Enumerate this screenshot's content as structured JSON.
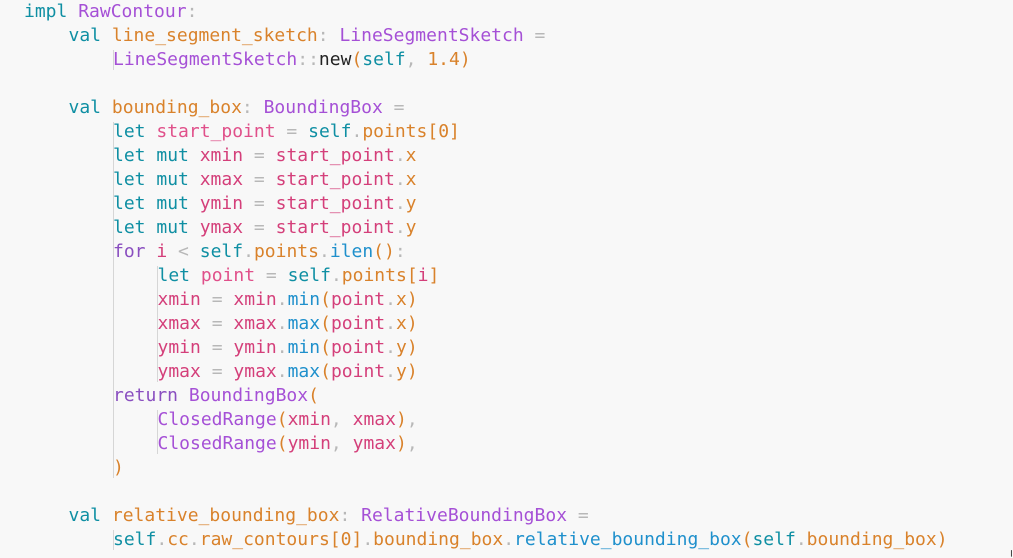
{
  "editor": {
    "language": "custom",
    "background": "#f8f8f8",
    "colors": {
      "keyword": "#0f8fa3",
      "control": "#8a4fc0",
      "type": "#a550d6",
      "property": "#d9822b",
      "binding": "#e0508a",
      "variable": "#d43f7a",
      "method": "#1f90cc",
      "number": "#d9822b",
      "punctuation": "#b8b8b8",
      "plain": "#222222"
    },
    "lines": [
      {
        "indent": 0,
        "tokens": [
          [
            "kw",
            "impl"
          ],
          [
            "plain",
            " "
          ],
          [
            "type",
            "RawContour"
          ],
          [
            "punc",
            ":"
          ]
        ]
      },
      {
        "indent": 1,
        "tokens": [
          [
            "kw",
            "val"
          ],
          [
            "plain",
            " "
          ],
          [
            "prop",
            "line_segment_sketch"
          ],
          [
            "punc",
            ":"
          ],
          [
            "plain",
            " "
          ],
          [
            "type",
            "LineSegmentSketch"
          ],
          [
            "plain",
            " "
          ],
          [
            "punc",
            "="
          ]
        ]
      },
      {
        "indent": 2,
        "tokens": [
          [
            "type",
            "LineSegmentSketch"
          ],
          [
            "punc",
            "::"
          ],
          [
            "plain",
            "new"
          ],
          [
            "brk",
            "("
          ],
          [
            "self",
            "self"
          ],
          [
            "punc",
            ","
          ],
          [
            "plain",
            " "
          ],
          [
            "num",
            "1.4"
          ],
          [
            "brk",
            ")"
          ]
        ]
      },
      {
        "indent": 0,
        "tokens": []
      },
      {
        "indent": 1,
        "tokens": [
          [
            "kw",
            "val"
          ],
          [
            "plain",
            " "
          ],
          [
            "prop",
            "bounding_box"
          ],
          [
            "punc",
            ":"
          ],
          [
            "plain",
            " "
          ],
          [
            "type",
            "BoundingBox"
          ],
          [
            "plain",
            " "
          ],
          [
            "punc",
            "="
          ]
        ]
      },
      {
        "indent": 2,
        "tokens": [
          [
            "kw",
            "let"
          ],
          [
            "plain",
            " "
          ],
          [
            "bind",
            "start_point"
          ],
          [
            "plain",
            " "
          ],
          [
            "punc",
            "="
          ],
          [
            "plain",
            " "
          ],
          [
            "self",
            "self"
          ],
          [
            "punc",
            "."
          ],
          [
            "mem",
            "points"
          ],
          [
            "brk",
            "["
          ],
          [
            "num",
            "0"
          ],
          [
            "brk",
            "]"
          ]
        ]
      },
      {
        "indent": 2,
        "tokens": [
          [
            "kw",
            "let"
          ],
          [
            "plain",
            " "
          ],
          [
            "kw",
            "mut"
          ],
          [
            "plain",
            " "
          ],
          [
            "var",
            "xmin"
          ],
          [
            "plain",
            " "
          ],
          [
            "punc",
            "="
          ],
          [
            "plain",
            " "
          ],
          [
            "var",
            "start_point"
          ],
          [
            "punc",
            "."
          ],
          [
            "mem",
            "x"
          ]
        ]
      },
      {
        "indent": 2,
        "tokens": [
          [
            "kw",
            "let"
          ],
          [
            "plain",
            " "
          ],
          [
            "kw",
            "mut"
          ],
          [
            "plain",
            " "
          ],
          [
            "var",
            "xmax"
          ],
          [
            "plain",
            " "
          ],
          [
            "punc",
            "="
          ],
          [
            "plain",
            " "
          ],
          [
            "var",
            "start_point"
          ],
          [
            "punc",
            "."
          ],
          [
            "mem",
            "x"
          ]
        ]
      },
      {
        "indent": 2,
        "tokens": [
          [
            "kw",
            "let"
          ],
          [
            "plain",
            " "
          ],
          [
            "kw",
            "mut"
          ],
          [
            "plain",
            " "
          ],
          [
            "var",
            "ymin"
          ],
          [
            "plain",
            " "
          ],
          [
            "punc",
            "="
          ],
          [
            "plain",
            " "
          ],
          [
            "var",
            "start_point"
          ],
          [
            "punc",
            "."
          ],
          [
            "mem",
            "y"
          ]
        ]
      },
      {
        "indent": 2,
        "tokens": [
          [
            "kw",
            "let"
          ],
          [
            "plain",
            " "
          ],
          [
            "kw",
            "mut"
          ],
          [
            "plain",
            " "
          ],
          [
            "var",
            "ymax"
          ],
          [
            "plain",
            " "
          ],
          [
            "punc",
            "="
          ],
          [
            "plain",
            " "
          ],
          [
            "var",
            "start_point"
          ],
          [
            "punc",
            "."
          ],
          [
            "mem",
            "y"
          ]
        ]
      },
      {
        "indent": 2,
        "tokens": [
          [
            "ctl",
            "for"
          ],
          [
            "plain",
            " "
          ],
          [
            "var",
            "i"
          ],
          [
            "plain",
            " "
          ],
          [
            "punc",
            "<"
          ],
          [
            "plain",
            " "
          ],
          [
            "self",
            "self"
          ],
          [
            "punc",
            "."
          ],
          [
            "mem",
            "points"
          ],
          [
            "punc",
            "."
          ],
          [
            "meth",
            "ilen"
          ],
          [
            "brk",
            "()"
          ],
          [
            "punc",
            ":"
          ]
        ]
      },
      {
        "indent": 3,
        "tokens": [
          [
            "kw",
            "let"
          ],
          [
            "plain",
            " "
          ],
          [
            "bind",
            "point"
          ],
          [
            "plain",
            " "
          ],
          [
            "punc",
            "="
          ],
          [
            "plain",
            " "
          ],
          [
            "self",
            "self"
          ],
          [
            "punc",
            "."
          ],
          [
            "mem",
            "points"
          ],
          [
            "brk",
            "["
          ],
          [
            "var",
            "i"
          ],
          [
            "brk",
            "]"
          ]
        ]
      },
      {
        "indent": 3,
        "tokens": [
          [
            "var",
            "xmin"
          ],
          [
            "plain",
            " "
          ],
          [
            "punc",
            "="
          ],
          [
            "plain",
            " "
          ],
          [
            "var",
            "xmin"
          ],
          [
            "punc",
            "."
          ],
          [
            "meth",
            "min"
          ],
          [
            "brk",
            "("
          ],
          [
            "var",
            "point"
          ],
          [
            "punc",
            "."
          ],
          [
            "mem",
            "x"
          ],
          [
            "brk",
            ")"
          ]
        ]
      },
      {
        "indent": 3,
        "tokens": [
          [
            "var",
            "xmax"
          ],
          [
            "plain",
            " "
          ],
          [
            "punc",
            "="
          ],
          [
            "plain",
            " "
          ],
          [
            "var",
            "xmax"
          ],
          [
            "punc",
            "."
          ],
          [
            "meth",
            "max"
          ],
          [
            "brk",
            "("
          ],
          [
            "var",
            "point"
          ],
          [
            "punc",
            "."
          ],
          [
            "mem",
            "x"
          ],
          [
            "brk",
            ")"
          ]
        ]
      },
      {
        "indent": 3,
        "tokens": [
          [
            "var",
            "ymin"
          ],
          [
            "plain",
            " "
          ],
          [
            "punc",
            "="
          ],
          [
            "plain",
            " "
          ],
          [
            "var",
            "ymin"
          ],
          [
            "punc",
            "."
          ],
          [
            "meth",
            "min"
          ],
          [
            "brk",
            "("
          ],
          [
            "var",
            "point"
          ],
          [
            "punc",
            "."
          ],
          [
            "mem",
            "y"
          ],
          [
            "brk",
            ")"
          ]
        ]
      },
      {
        "indent": 3,
        "tokens": [
          [
            "var",
            "ymax"
          ],
          [
            "plain",
            " "
          ],
          [
            "punc",
            "="
          ],
          [
            "plain",
            " "
          ],
          [
            "var",
            "ymax"
          ],
          [
            "punc",
            "."
          ],
          [
            "meth",
            "max"
          ],
          [
            "brk",
            "("
          ],
          [
            "var",
            "point"
          ],
          [
            "punc",
            "."
          ],
          [
            "mem",
            "y"
          ],
          [
            "brk",
            ")"
          ]
        ]
      },
      {
        "indent": 2,
        "tokens": [
          [
            "ctl",
            "return"
          ],
          [
            "plain",
            " "
          ],
          [
            "fn",
            "BoundingBox"
          ],
          [
            "brk",
            "("
          ]
        ]
      },
      {
        "indent": 3,
        "tokens": [
          [
            "fn",
            "ClosedRange"
          ],
          [
            "brk",
            "("
          ],
          [
            "var",
            "xmin"
          ],
          [
            "punc",
            ","
          ],
          [
            "plain",
            " "
          ],
          [
            "var",
            "xmax"
          ],
          [
            "brk",
            ")"
          ],
          [
            "punc",
            ","
          ]
        ]
      },
      {
        "indent": 3,
        "tokens": [
          [
            "fn",
            "ClosedRange"
          ],
          [
            "brk",
            "("
          ],
          [
            "var",
            "ymin"
          ],
          [
            "punc",
            ","
          ],
          [
            "plain",
            " "
          ],
          [
            "var",
            "ymax"
          ],
          [
            "brk",
            ")"
          ],
          [
            "punc",
            ","
          ]
        ]
      },
      {
        "indent": 2,
        "tokens": [
          [
            "brk",
            ")"
          ]
        ]
      },
      {
        "indent": 0,
        "tokens": []
      },
      {
        "indent": 1,
        "tokens": [
          [
            "kw",
            "val"
          ],
          [
            "plain",
            " "
          ],
          [
            "prop",
            "relative_bounding_box"
          ],
          [
            "punc",
            ":"
          ],
          [
            "plain",
            " "
          ],
          [
            "type",
            "RelativeBoundingBox"
          ],
          [
            "plain",
            " "
          ],
          [
            "punc",
            "="
          ]
        ]
      },
      {
        "indent": 2,
        "tokens": [
          [
            "self",
            "self"
          ],
          [
            "punc",
            "."
          ],
          [
            "mem",
            "cc"
          ],
          [
            "punc",
            "."
          ],
          [
            "mem",
            "raw_contours"
          ],
          [
            "brk",
            "["
          ],
          [
            "num",
            "0"
          ],
          [
            "brk",
            "]"
          ],
          [
            "punc",
            "."
          ],
          [
            "mem",
            "bounding_box"
          ],
          [
            "punc",
            "."
          ],
          [
            "meth",
            "relative_bounding_box"
          ],
          [
            "brk",
            "("
          ],
          [
            "self",
            "self"
          ],
          [
            "punc",
            "."
          ],
          [
            "mem",
            "bounding_box"
          ],
          [
            "brk",
            ")"
          ]
        ]
      }
    ]
  }
}
